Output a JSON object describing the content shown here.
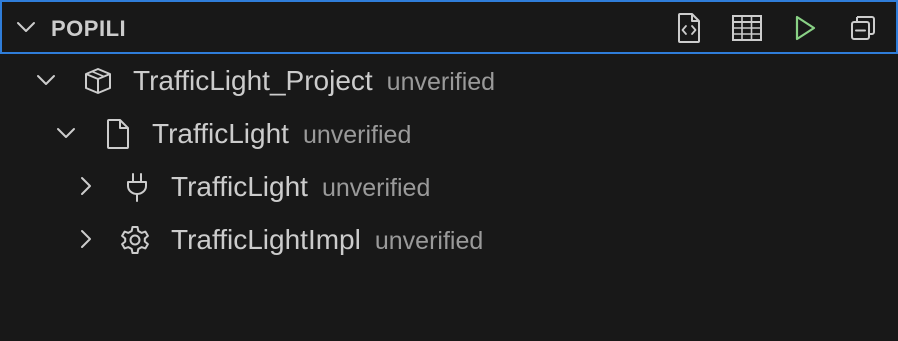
{
  "panel": {
    "title": "POPILI",
    "colors": {
      "border": "#2f7dd9",
      "run": "#89d185",
      "foreground": "#cccccc",
      "description": "#9a9a9a",
      "background": "#181818"
    },
    "toolbar": [
      {
        "icon": "code-file-icon"
      },
      {
        "icon": "table-icon"
      },
      {
        "icon": "run-icon"
      },
      {
        "icon": "collapse-all-icon"
      }
    ]
  },
  "tree": [
    {
      "label": "TrafficLight_Project",
      "description": "unverified",
      "icon": "package-icon",
      "expanded": true,
      "level": 0
    },
    {
      "label": "TrafficLight",
      "description": "unverified",
      "icon": "file-icon",
      "expanded": true,
      "level": 1
    },
    {
      "label": "TrafficLight",
      "description": "unverified",
      "icon": "plug-icon",
      "expanded": false,
      "level": 2
    },
    {
      "label": "TrafficLightImpl",
      "description": "unverified",
      "icon": "gear-icon",
      "expanded": false,
      "level": 2
    }
  ]
}
